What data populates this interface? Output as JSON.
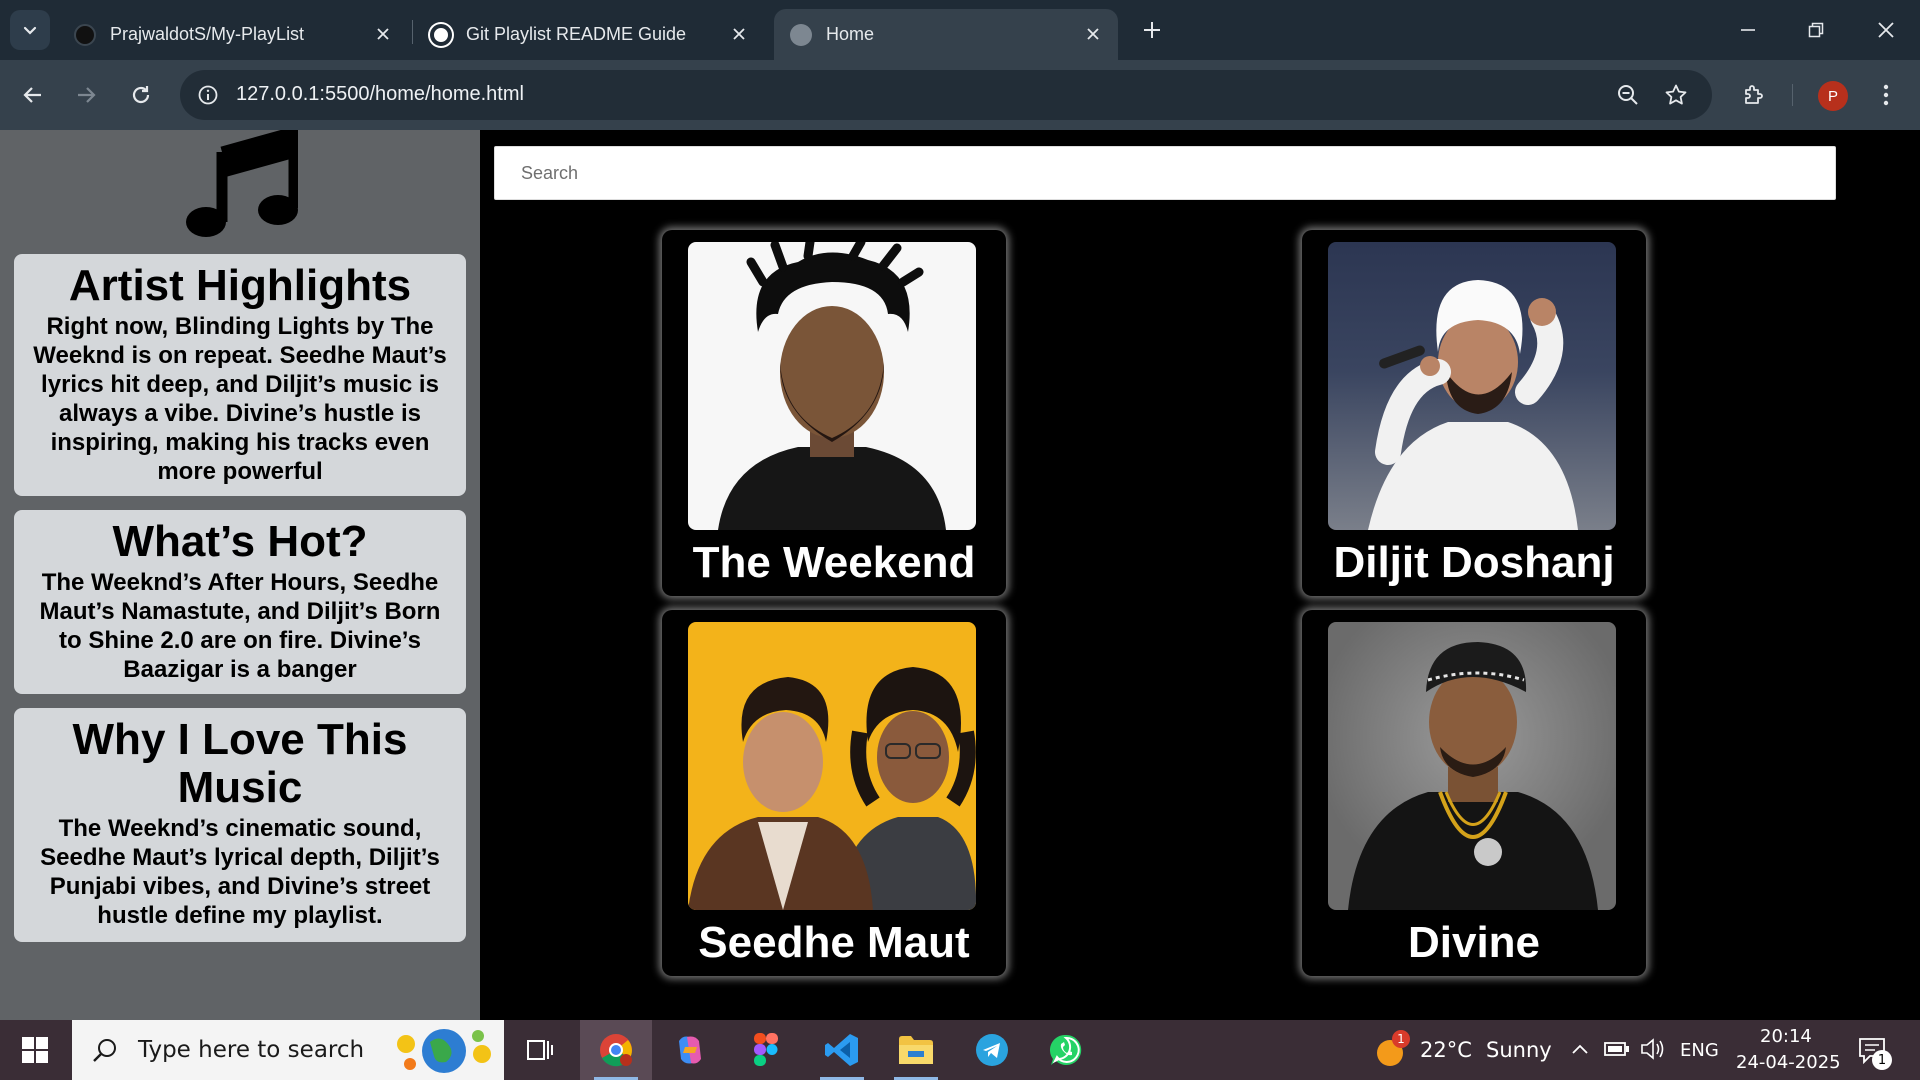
{
  "browser": {
    "tabs": [
      {
        "title": "PrajwaldotS/My-PlayList",
        "active": false
      },
      {
        "title": "Git Playlist README Guide",
        "active": false
      },
      {
        "title": "Home",
        "active": true
      }
    ],
    "url": "127.0.0.1:5500/home/home.html"
  },
  "sidebar": {
    "cards": [
      {
        "title": "Artist Highlights",
        "text": "Right now, Blinding Lights by The Weeknd is on repeat. Seedhe Maut’s lyrics hit deep, and Diljit’s music is always a vibe. Divine’s hustle is inspiring, making his tracks even more powerful"
      },
      {
        "title": "What’s Hot?",
        "text": "The Weeknd’s After Hours, Seedhe Maut’s Namastute, and Diljit’s Born to Shine 2.0 are on fire. Divine’s Baazigar is a banger"
      },
      {
        "title": "Why I Love This Music",
        "text": "The Weeknd’s cinematic sound, Seedhe Maut’s lyrical depth, Diljit’s Punjabi vibes, and Divine’s street hustle define my playlist."
      }
    ]
  },
  "main": {
    "search_placeholder": "Search",
    "artists": [
      {
        "name": "The Weekend"
      },
      {
        "name": "Diljit Doshanj"
      },
      {
        "name": "Seedhe Maut"
      },
      {
        "name": "Divine"
      }
    ]
  },
  "taskbar": {
    "search_placeholder": "Type here to search",
    "weather_temp": "22°C",
    "weather_desc": "Sunny",
    "weather_badge": "1",
    "language": "ENG",
    "time": "20:14",
    "date": "24-04-2025",
    "notification_count": "1"
  },
  "colors": {
    "sidebar_bg": "#606366",
    "card_bg": "#d4d7da",
    "chrome_dark": "#1f2b36",
    "chrome_toolbar": "#35414c",
    "taskbar_bg": "#3a2d36"
  }
}
